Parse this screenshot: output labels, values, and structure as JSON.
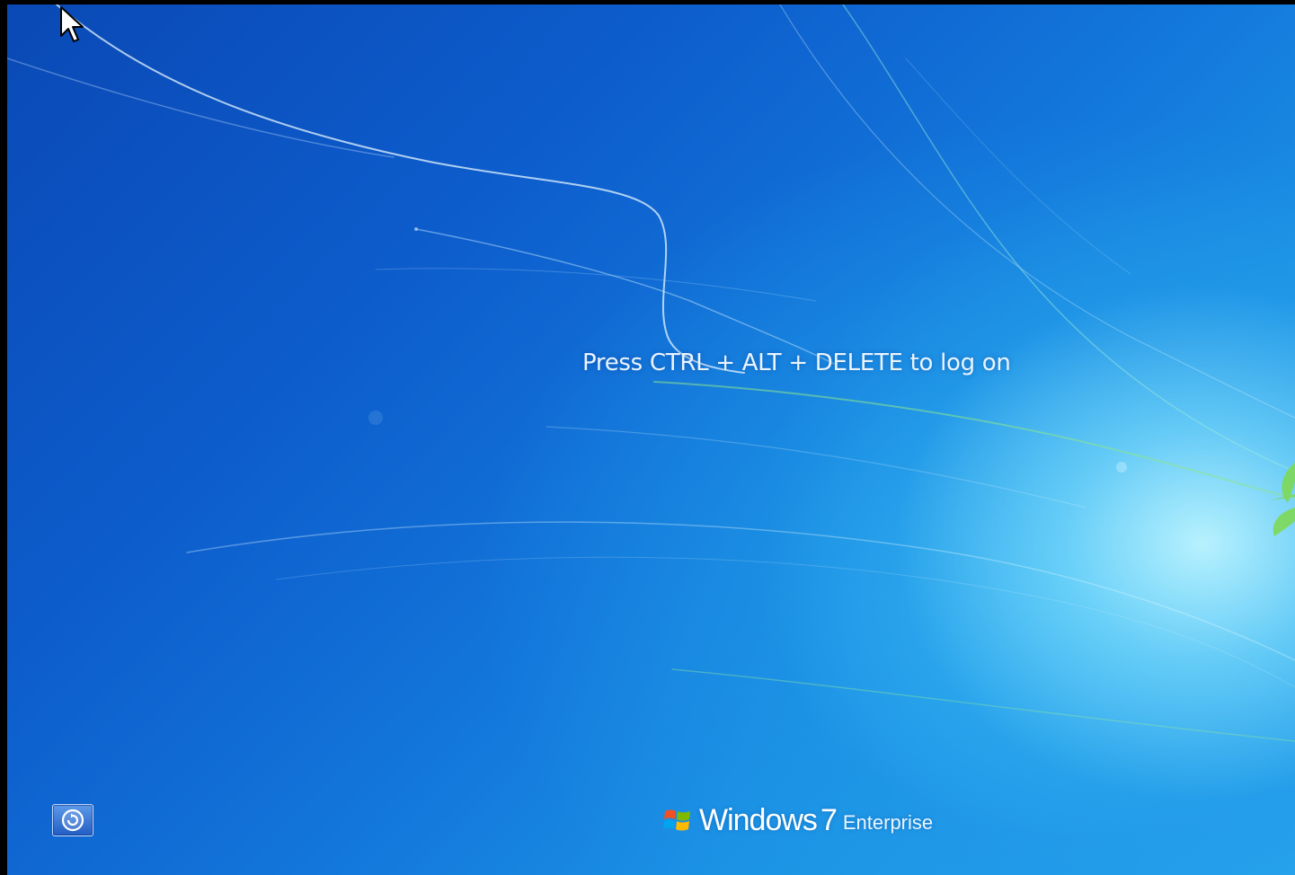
{
  "logon": {
    "prompt": "Press CTRL + ALT + DELETE to log on"
  },
  "branding": {
    "name": "Windows",
    "version": "7",
    "edition": "Enterprise"
  },
  "ease_of_access": {
    "icon": "ease-of-access-icon"
  },
  "colors": {
    "background_dark": "#0a49b5",
    "background_light": "#9ee8ff",
    "text": "#eaf4ff",
    "flag_red": "#f25022",
    "flag_green": "#7fba00",
    "flag_blue": "#00a4ef",
    "flag_yellow": "#ffb900"
  }
}
